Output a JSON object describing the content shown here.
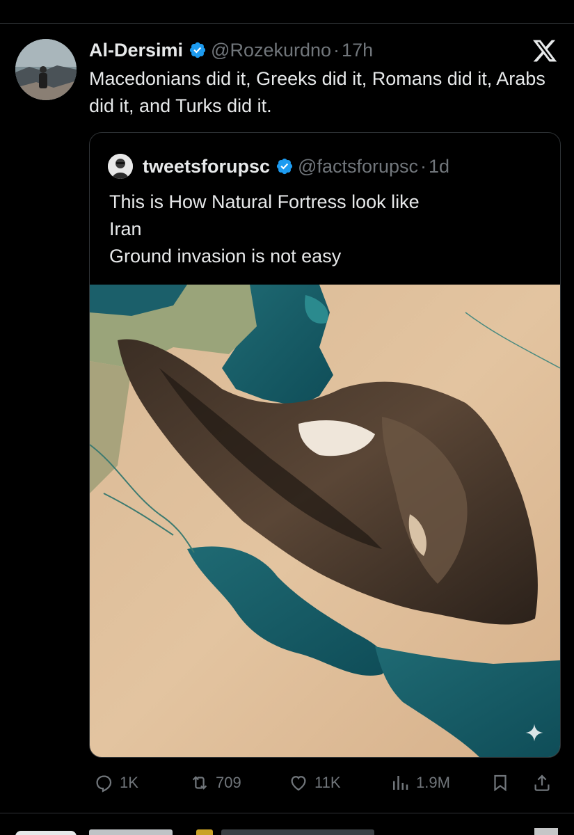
{
  "post": {
    "author_name": "Al-Dersimi",
    "handle": "@Rozekurdno",
    "separator": "·",
    "time": "17h",
    "text": "Macedonians did it, Greeks did it, Romans  did it, Arabs did it, and Turks did it."
  },
  "quoted_post": {
    "author_name": "tweetsforupsc",
    "handle": "@factsforupsc",
    "separator": "·",
    "time": "1d",
    "text_lines": [
      "This is How Natural Fortress look like",
      "Iran",
      "Ground invasion is not easy"
    ],
    "media_icon": "sparkle-icon"
  },
  "actions": {
    "replies": "1K",
    "reposts": "709",
    "likes": "11K",
    "views": "1.9M"
  },
  "colors": {
    "background": "#000000",
    "text_primary": "#e7e9ea",
    "text_secondary": "#71767b",
    "verified": "#1d9bf0",
    "border": "#2f3336"
  }
}
